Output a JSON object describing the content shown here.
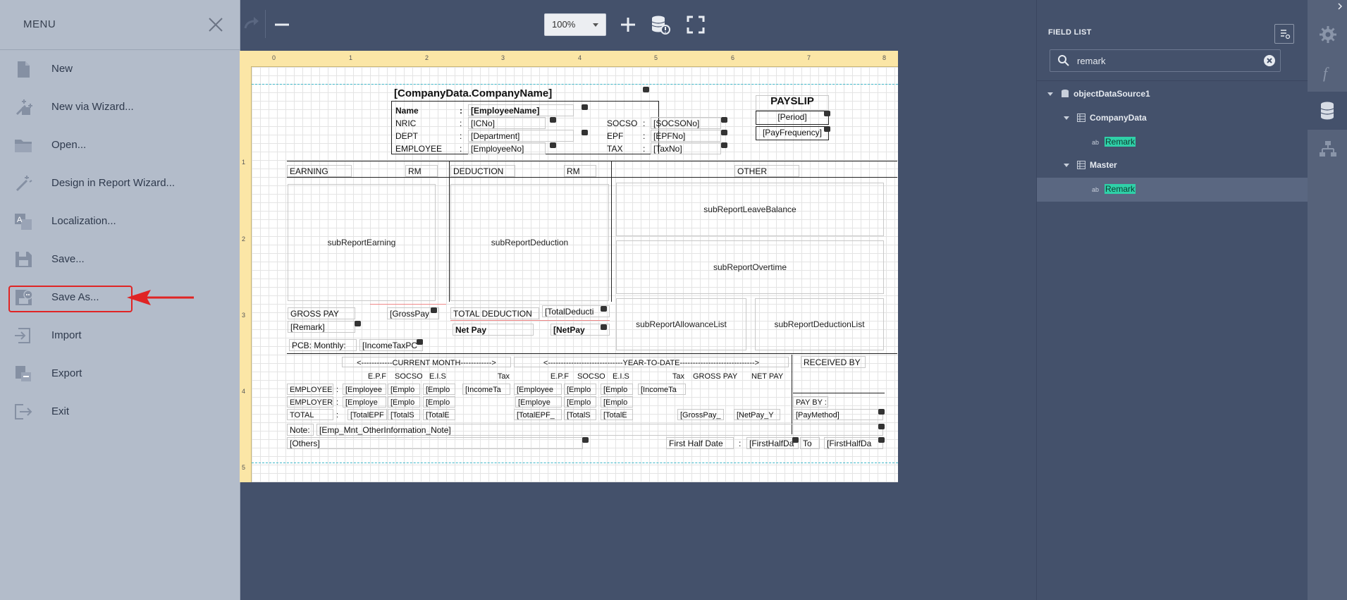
{
  "menu": {
    "title": "MENU",
    "items": [
      {
        "label": "New",
        "icon": "file-icon"
      },
      {
        "label": "New via Wizard...",
        "icon": "wizard-icon"
      },
      {
        "label": "Open...",
        "icon": "folder-open-icon"
      },
      {
        "label": "Design in Report Wizard...",
        "icon": "magic-wand-icon"
      },
      {
        "label": "Localization...",
        "icon": "translate-icon"
      },
      {
        "label": "Save...",
        "icon": "save-icon"
      },
      {
        "label": "Save As...",
        "icon": "save-as-icon"
      },
      {
        "label": "Import",
        "icon": "import-icon"
      },
      {
        "label": "Export",
        "icon": "export-icon"
      },
      {
        "label": "Exit",
        "icon": "exit-icon"
      }
    ],
    "highlighted": "Save As...",
    "annotation_color": "#e02424"
  },
  "toolbar": {
    "zoom_value": "100%"
  },
  "ruler": {
    "labels": [
      "0",
      "1",
      "2",
      "3",
      "4",
      "5",
      "6",
      "7",
      "8"
    ],
    "left_labels": [
      "1",
      "2",
      "3",
      "4",
      "5"
    ]
  },
  "report": {
    "company": "[CompanyData.CompanyName]",
    "payslip": "PAYSLIP",
    "period": "[Period]",
    "pay_frequency": "[PayFrequency]",
    "emp_labels": [
      "Name",
      "NRIC",
      "DEPT",
      "EMPLOYEE"
    ],
    "colon": ":",
    "emp_values": [
      "[EmployeeName]",
      "[ICNo]",
      "[Department]",
      "[EmployeeNo]"
    ],
    "stat_labels": [
      "SOCSO",
      "EPF",
      "TAX"
    ],
    "stat_values": [
      "[SOCSONo]",
      "[EPFNo]",
      "[TaxNo]"
    ],
    "earning": "EARNING",
    "rm": "RM",
    "deduction": "DEDUCTION",
    "other": "OTHER",
    "sub_earning": "subReportEarning",
    "sub_deduction": "subReportDeduction",
    "sub_leave": "subReportLeaveBalance",
    "sub_overtime": "subReportOvertime",
    "sub_allowance": "subReportAllowanceList",
    "sub_deduction_list": "subReportDeductionList",
    "gross_pay": "GROSS PAY",
    "gross_pay_val": "[GrossPay",
    "total_deduction": "TOTAL DEDUCTION",
    "total_deduction_val": "[TotalDeducti",
    "remark": "[Remark]",
    "net_pay": "Net Pay",
    "net_pay_val": "[NetPay",
    "pcb": "PCB: Monthly:",
    "pcb_val": "[IncomeTaxPC",
    "current_month": "<------------CURRENT MONTH------------>",
    "ytd": "<-----------------------------YEAR-TO-DATE----------------------------->",
    "received_by": "RECEIVED BY",
    "cols": [
      "E.P.F",
      "SOCSO",
      "E.I.S",
      "Tax"
    ],
    "ytd_cols": [
      "E.P.F",
      "SOCSO",
      "E.I.S",
      "Tax",
      "GROSS PAY",
      "NET PAY"
    ],
    "rows": [
      "EMPLOYEE",
      "EMPLOYER",
      "TOTAL"
    ],
    "cm_employee": [
      "[Employee",
      "[Emplo",
      "[Emplo",
      "[IncomeTa"
    ],
    "cm_employer": [
      "[Employe",
      "[Emplo",
      "[Emplo"
    ],
    "cm_total": [
      "[TotalEPF",
      "[TotalS",
      "[TotalE"
    ],
    "ytd_employee": [
      "[Employee",
      "[Emplo",
      "[Emplo",
      "[IncomeTa"
    ],
    "ytd_employer": [
      "[Employe",
      "[Emplo",
      "[Emplo"
    ],
    "ytd_total": [
      "[TotalEPF_",
      "[TotalS",
      "[TotalE",
      "[GrossPay_",
      "[NetPay_Y"
    ],
    "pay_by": "PAY BY :",
    "pay_method": "[PayMethod]",
    "note": "Note:",
    "note_val": "[Emp_Mnt_OtherInformation_Note]",
    "others": "[Others]",
    "first_half": "First Half Date",
    "first_half_val": "[FirstHalfDa",
    "to": "To",
    "first_half_val2": "[FirstHalfDa"
  },
  "field_list": {
    "title": "FIELD LIST",
    "search_value": "remark",
    "tree": [
      {
        "label": "objectDataSource1",
        "icon": "database-icon"
      },
      {
        "label": "CompanyData",
        "icon": "table-icon"
      },
      {
        "label": "Remark",
        "icon": "field-icon"
      },
      {
        "label": "Master",
        "icon": "table-icon"
      },
      {
        "label": "Remark",
        "icon": "field-icon"
      }
    ]
  },
  "rail": {
    "buttons": [
      "gear-icon",
      "function-icon",
      "database-icon",
      "hierarchy-icon"
    ],
    "active": "database-icon"
  },
  "colors": {
    "menu_bg": "#b3bcca",
    "app_bg": "#44516b",
    "ruler": "#fbe6a6",
    "highlight": "#2fd0a8"
  }
}
